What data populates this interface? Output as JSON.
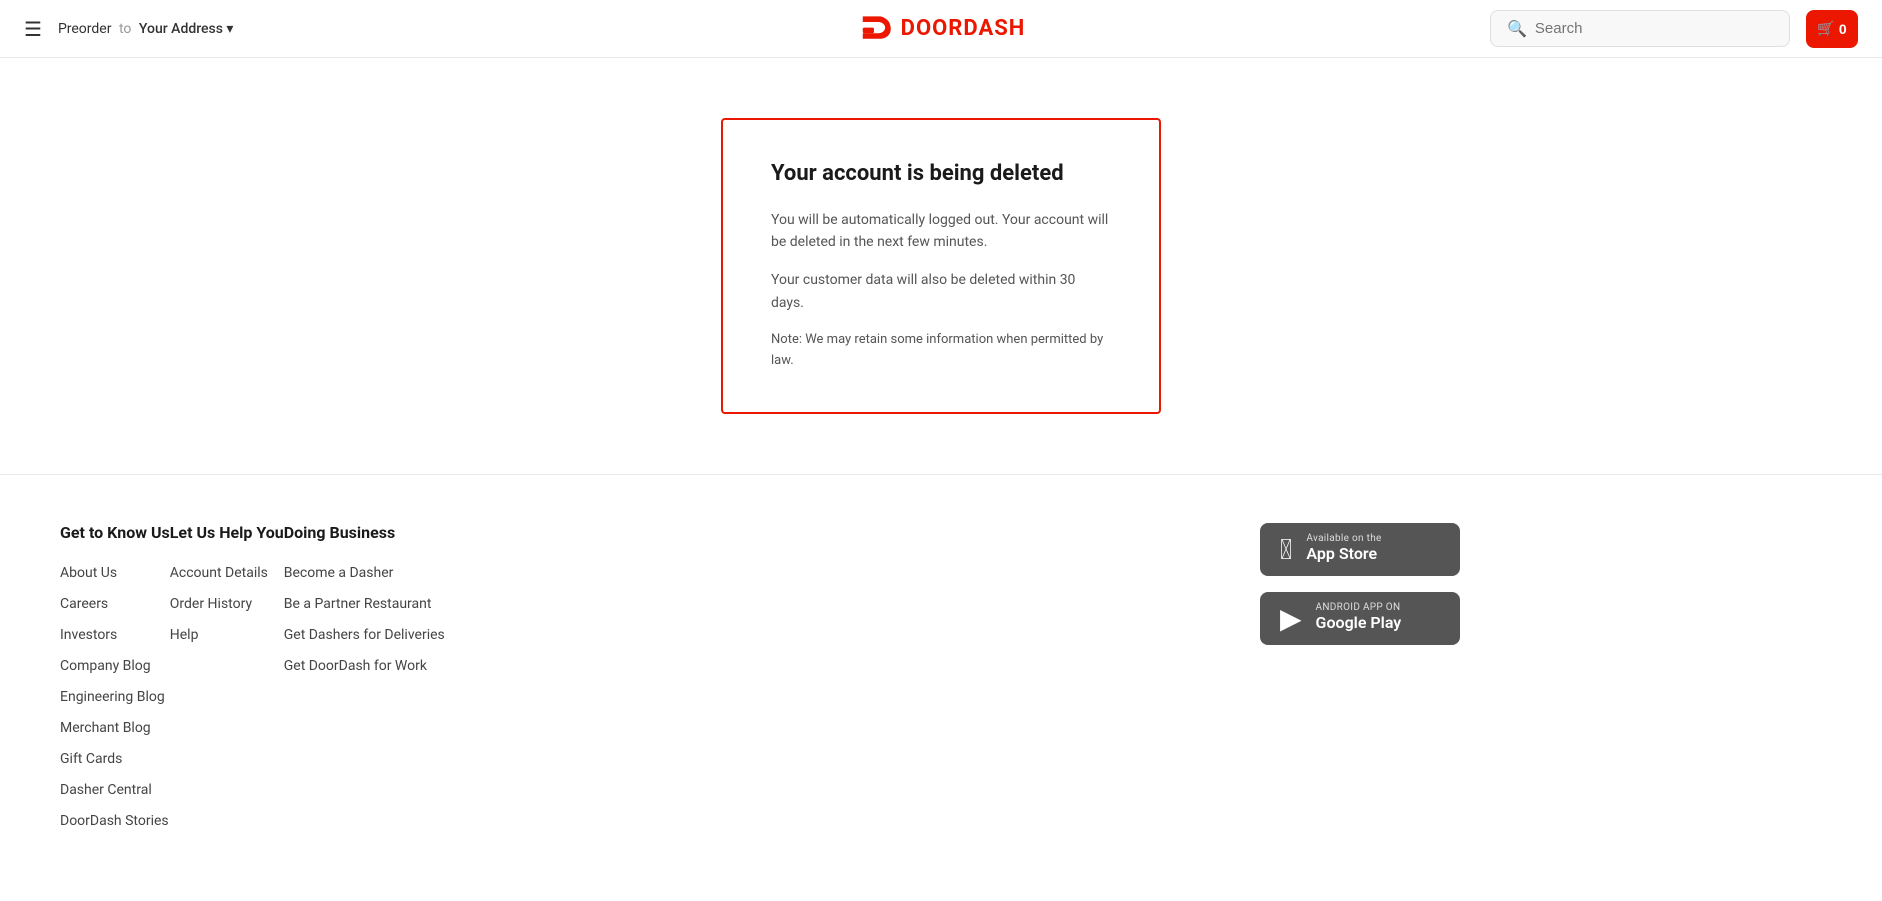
{
  "header": {
    "hamburger_label": "☰",
    "preorder_prefix": "Preorder",
    "preorder_to": "to",
    "preorder_address": "Your Address ▾",
    "logo_text": "DOORDASH",
    "search_placeholder": "Search",
    "cart_count": "0"
  },
  "main": {
    "card": {
      "title": "Your account is being deleted",
      "paragraph1": "You will be automatically logged out. Your account will be deleted in the next few minutes.",
      "paragraph2": "Your customer data will also be deleted within 30 days.",
      "note": "Note: We may retain some information when permitted by law."
    }
  },
  "footer": {
    "col1": {
      "heading": "Get to Know Us",
      "links": [
        "About Us",
        "Careers",
        "Investors",
        "Company Blog",
        "Engineering Blog",
        "Merchant Blog",
        "Gift Cards",
        "Dasher Central",
        "DoorDash Stories"
      ]
    },
    "col2": {
      "heading": "Let Us Help You",
      "links": [
        "Account Details",
        "Order History",
        "Help"
      ]
    },
    "col3": {
      "heading": "Doing Business",
      "links": [
        "Become a Dasher",
        "Be a Partner Restaurant",
        "Get Dashers for Deliveries",
        "Get DoorDash for Work"
      ]
    },
    "apps": {
      "appstore": {
        "small": "Available on the",
        "big": "App Store"
      },
      "googleplay": {
        "small": "ANDROID APP ON",
        "big": "Google Play"
      }
    }
  }
}
